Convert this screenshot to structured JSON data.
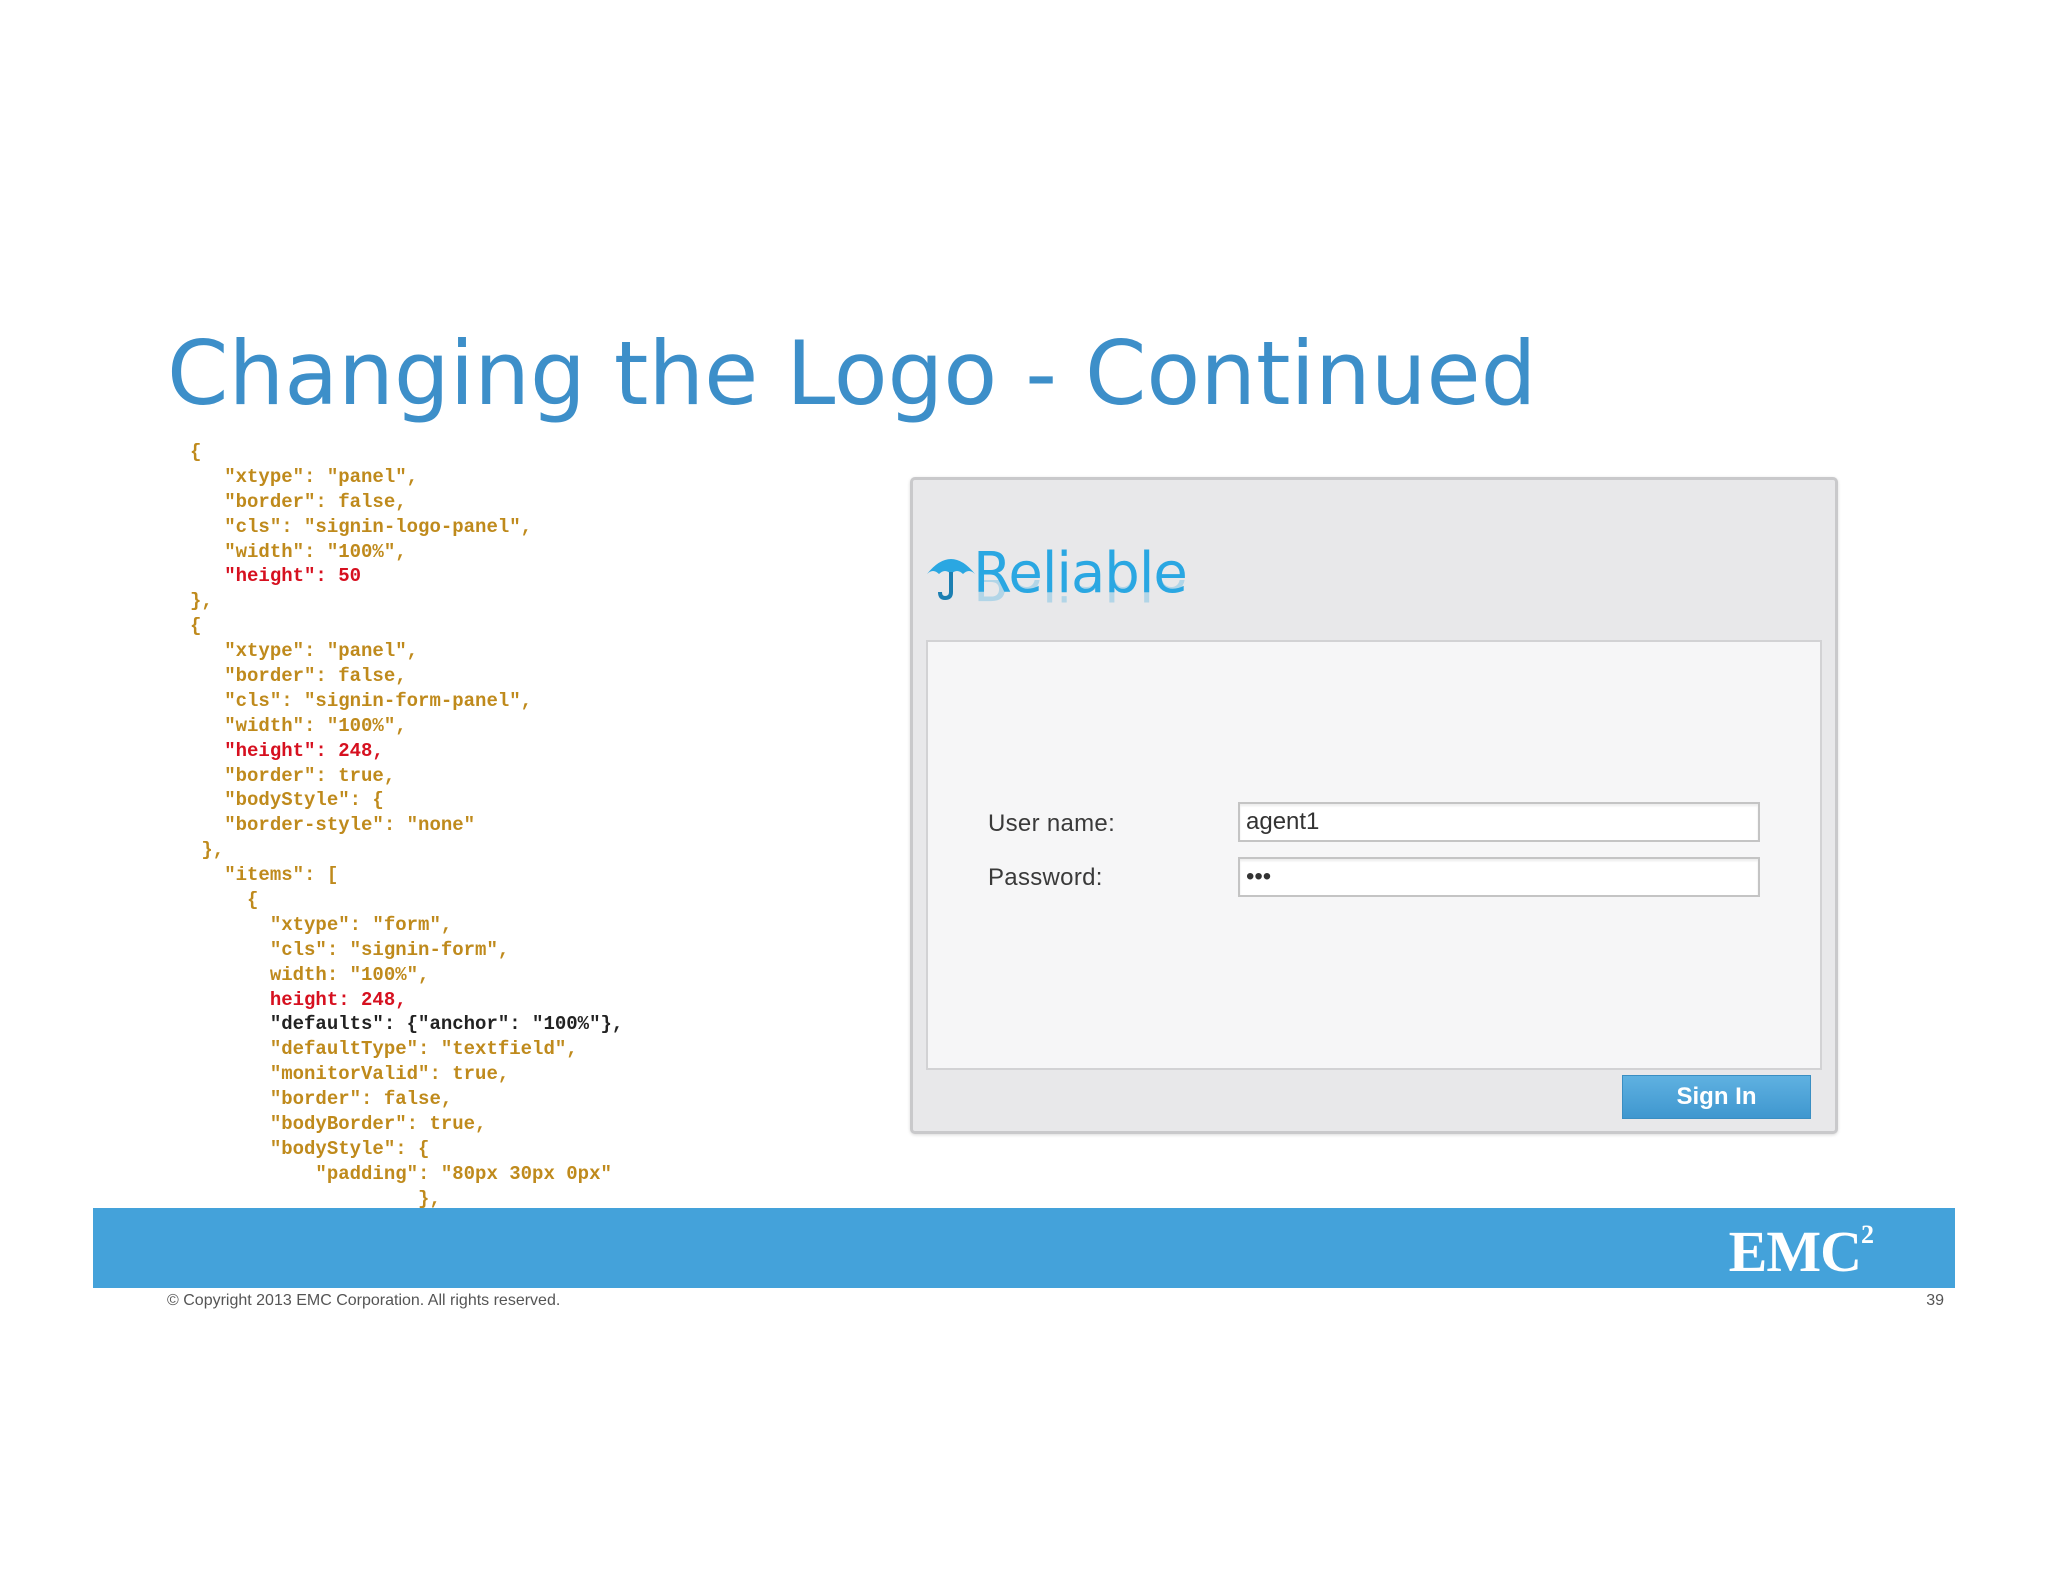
{
  "slide": {
    "title": "Changing the Logo - Continued"
  },
  "code": [
    {
      "text": "{",
      "style": "normal"
    },
    {
      "text": "   \"xtype\": \"panel\",",
      "style": "normal"
    },
    {
      "text": "   \"border\": false,",
      "style": "normal"
    },
    {
      "text": "   \"cls\": \"signin-logo-panel\",",
      "style": "normal"
    },
    {
      "text": "   \"width\": \"100%\",",
      "style": "normal"
    },
    {
      "text": "   \"height\": 50",
      "style": "red"
    },
    {
      "text": "},",
      "style": "normal"
    },
    {
      "text": "{",
      "style": "normal"
    },
    {
      "text": "   \"xtype\": \"panel\",",
      "style": "normal"
    },
    {
      "text": "   \"border\": false,",
      "style": "normal"
    },
    {
      "text": "   \"cls\": \"signin-form-panel\",",
      "style": "normal"
    },
    {
      "text": "   \"width\": \"100%\",",
      "style": "normal"
    },
    {
      "text": "   \"height\": 248,",
      "style": "red"
    },
    {
      "text": "   \"border\": true,",
      "style": "normal"
    },
    {
      "text": "   \"bodyStyle\": {",
      "style": "normal"
    },
    {
      "text": "   \"border-style\": \"none\"",
      "style": "normal"
    },
    {
      "text": " },",
      "style": "normal"
    },
    {
      "text": "   \"items\": [",
      "style": "normal"
    },
    {
      "text": "     {",
      "style": "normal"
    },
    {
      "text": "       \"xtype\": \"form\",",
      "style": "normal"
    },
    {
      "text": "       \"cls\": \"signin-form\",",
      "style": "normal"
    },
    {
      "text": "       width: \"100%\",",
      "style": "normal"
    },
    {
      "text": "       height: 248,",
      "style": "red"
    },
    {
      "text": "       \"defaults\": {\"anchor\": \"100%\"},",
      "style": "dark"
    },
    {
      "text": "       \"defaultType\": \"textfield\",",
      "style": "normal"
    },
    {
      "text": "       \"monitorValid\": true,",
      "style": "normal"
    },
    {
      "text": "       \"border\": false,",
      "style": "normal"
    },
    {
      "text": "       \"bodyBorder\": true,",
      "style": "normal"
    },
    {
      "text": "       \"bodyStyle\": {",
      "style": "normal"
    },
    {
      "text": "           \"padding\": \"80px 30px 0px\"",
      "style": "normal"
    },
    {
      "text": "                    },",
      "style": "normal"
    }
  ],
  "signin": {
    "logo_text": "Reliable",
    "username_label": "User name:",
    "username_value": "agent1",
    "password_label": "Password:",
    "password_value": "•••",
    "button_label": "Sign In"
  },
  "footer": {
    "copyright": "© Copyright 2013 EMC Corporation. All rights reserved.",
    "brand": "EMC",
    "brand_sup": "2",
    "page_number": "39"
  },
  "colors": {
    "title": "#3d8fc9",
    "code": "#bf8a1c",
    "code_highlight": "#d6101f",
    "footer_bar": "#44a2da",
    "logo": "#2aa7e2",
    "button": "#4aa3d8"
  }
}
